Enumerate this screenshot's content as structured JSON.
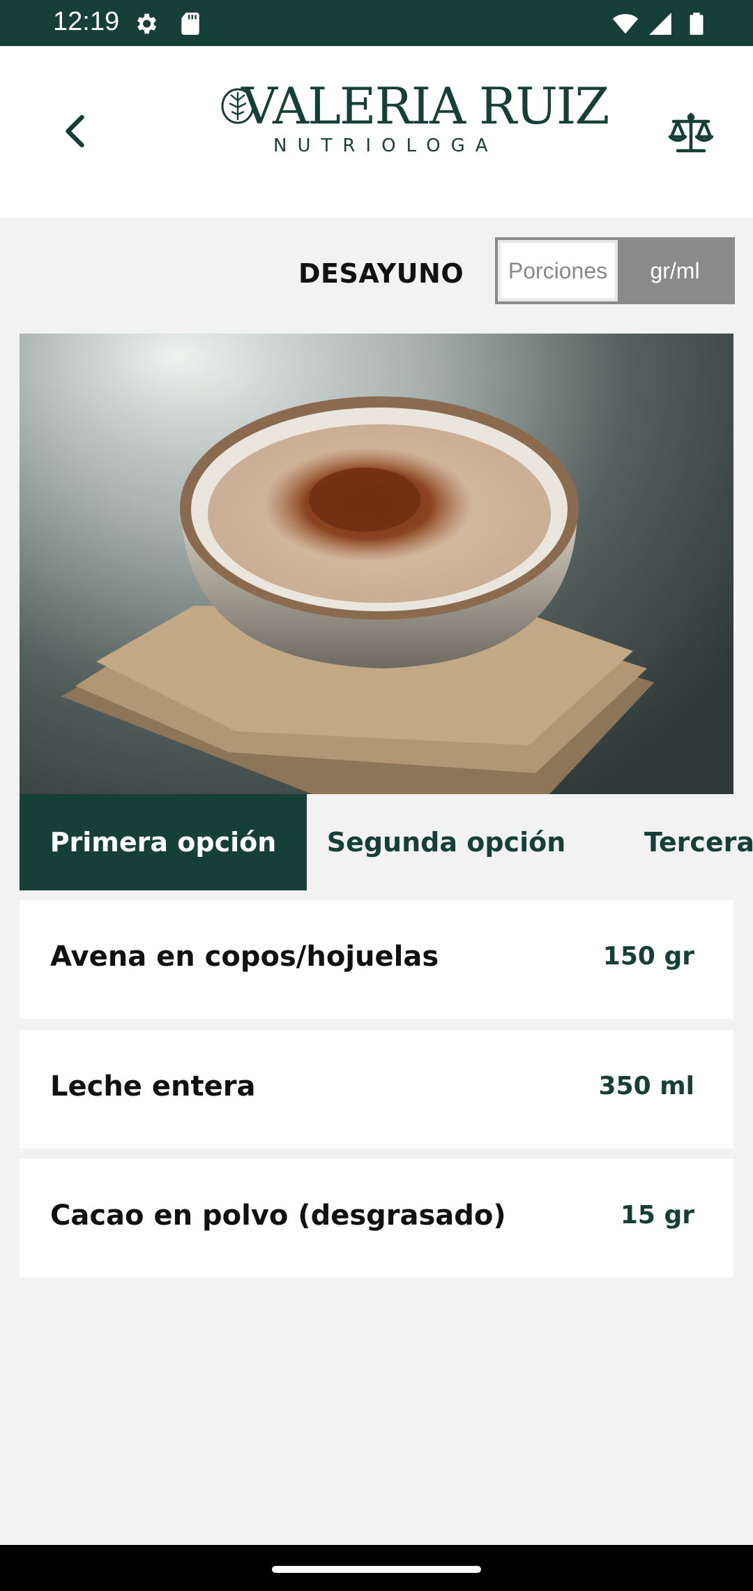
{
  "status_bar": {
    "time": "12:19"
  },
  "header": {
    "brand_name": "VALERIA RUIZ",
    "brand_subtitle": "NUTRIOLOGA"
  },
  "meal": {
    "title": "DESAYUNO",
    "toggle": {
      "option_1": "Porciones",
      "option_2": "gr/ml",
      "selected": "gr/ml"
    }
  },
  "tabs": [
    {
      "label": "Primera opción",
      "active": true
    },
    {
      "label": "Segunda opción",
      "active": false
    },
    {
      "label": "Tercera opción",
      "active": false
    }
  ],
  "ingredients": [
    {
      "name": "Avena en copos/hojuelas",
      "quantity": "150 gr"
    },
    {
      "name": "Leche entera",
      "quantity": "350 ml"
    },
    {
      "name": "Cacao en polvo (desgrasado)",
      "quantity": "15 gr"
    }
  ],
  "colors": {
    "primary": "#163f37",
    "background": "#f2f2f2",
    "toggle_gray": "#8a8a8a"
  },
  "icons": [
    "settings-icon",
    "sd-card-icon",
    "wifi-icon",
    "cellular-signal-icon",
    "battery-icon",
    "back-arrow-icon",
    "scale-icon"
  ]
}
